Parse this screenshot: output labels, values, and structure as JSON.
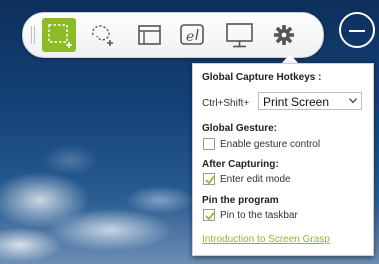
{
  "toolbar": {
    "tools": [
      {
        "id": "rect-capture",
        "icon": "rectangle-capture-icon",
        "active": true
      },
      {
        "id": "freeform-capture",
        "icon": "freeform-capture-icon",
        "active": false
      },
      {
        "id": "window-capture",
        "icon": "window-capture-icon",
        "active": false
      },
      {
        "id": "browser-capture",
        "icon": "browser-capture-icon",
        "active": false
      },
      {
        "id": "fullscreen-capture",
        "icon": "monitor-icon",
        "active": false
      },
      {
        "id": "settings",
        "icon": "gear-icon",
        "active": false
      }
    ],
    "accent": "#8dbb26"
  },
  "settings_panel": {
    "title": "Global Capture Hotkeys :",
    "hotkey_prefix": "Ctrl+Shift+",
    "hotkey_value": "Print Screen",
    "gesture": {
      "title": "Global Gesture:",
      "label": "Enable gesture control",
      "checked": false
    },
    "after": {
      "title": "After Capturing:",
      "label": "Enter edit mode",
      "checked": true
    },
    "pin": {
      "title": "Pin the program",
      "label": "Pin to the taskbar",
      "checked": true
    },
    "link": "Introduction to Screen Grasp"
  }
}
